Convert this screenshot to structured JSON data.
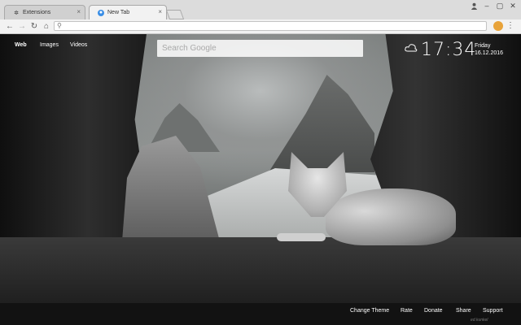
{
  "browser": {
    "tabs": [
      {
        "title": "Extensions",
        "icon": "puzzle-icon"
      },
      {
        "title": "New Tab",
        "icon": "globe-icon"
      }
    ],
    "close_glyph": "×"
  },
  "page": {
    "nav_links": [
      "Web",
      "Images",
      "Videos"
    ],
    "search_placeholder": "Search Google",
    "clock": {
      "time": "17:34",
      "day": "Friday",
      "date": "16.12.2016"
    },
    "footer_links": [
      "Change Theme",
      "Rate",
      "Donate",
      "Share",
      "Support"
    ],
    "credit": "ed.kunkel"
  },
  "colors": {
    "extension": "#e8a33a",
    "footer_bg": "#121212"
  }
}
